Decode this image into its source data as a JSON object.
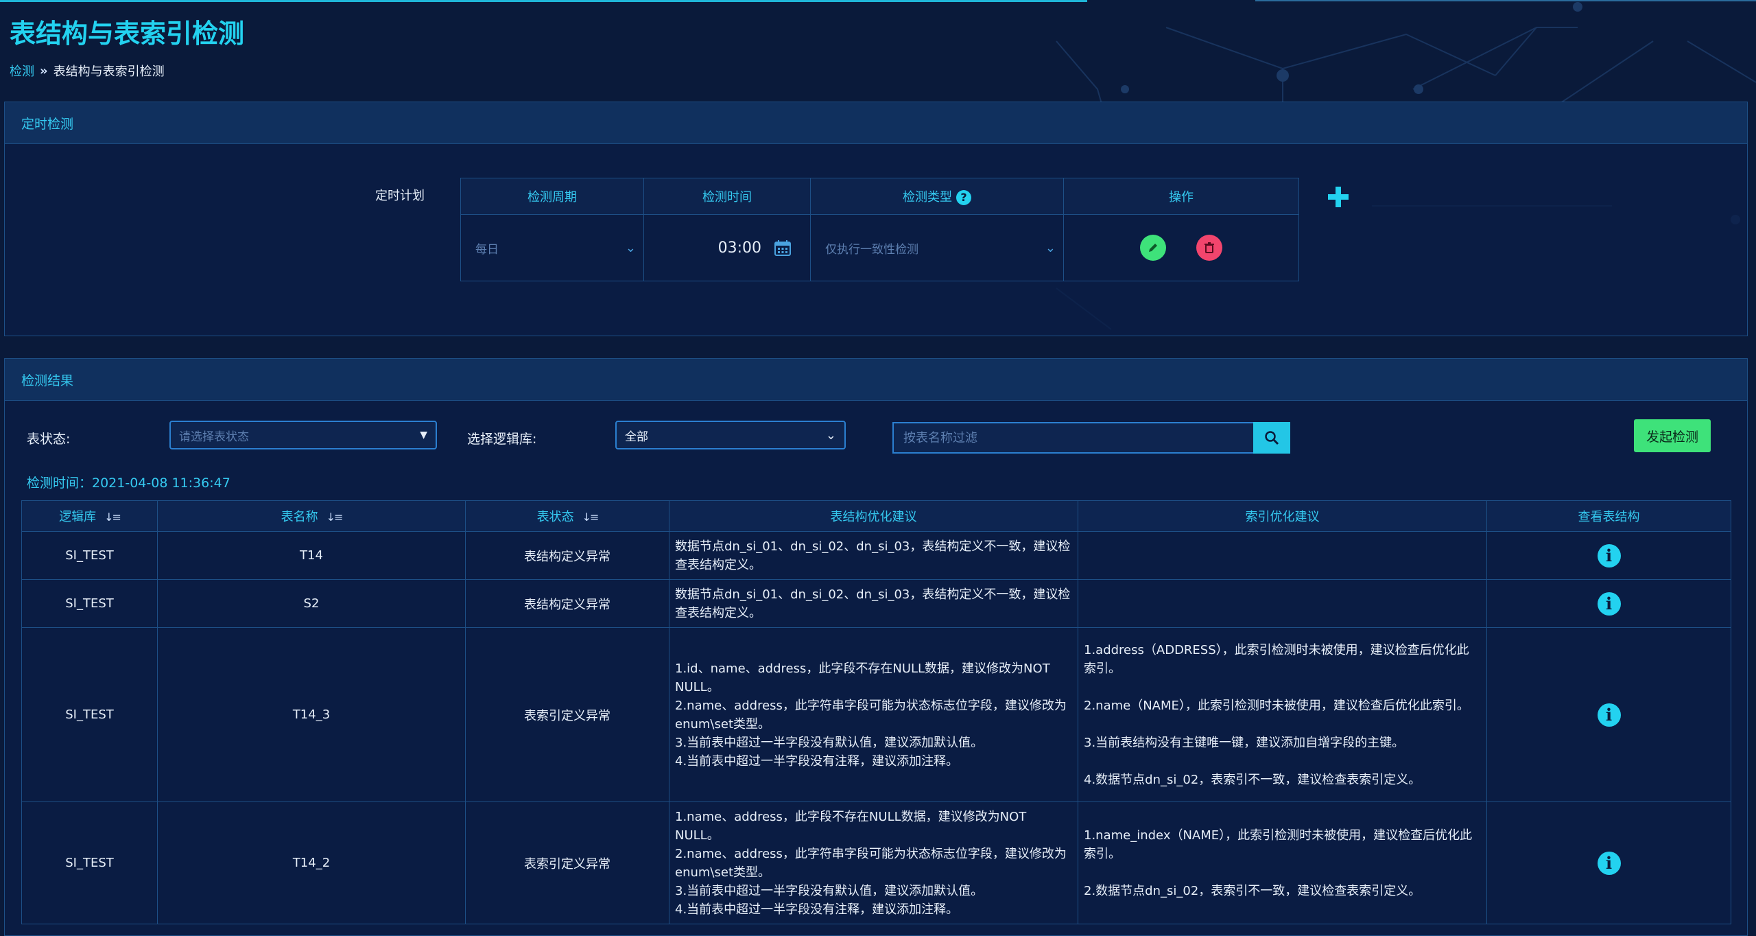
{
  "page": {
    "title": "表结构与表索引检测",
    "breadcrumb": {
      "parent": "检测",
      "separator": "»",
      "current": "表结构与表索引检测"
    }
  },
  "schedule_panel": {
    "title": "定时检测",
    "plan_label": "定时计划",
    "columns": {
      "period": "检测周期",
      "time": "检测时间",
      "type": "检测类型",
      "actions": "操作"
    },
    "row": {
      "period": "每日",
      "time": "03:00",
      "type": "仅执行一致性检测"
    },
    "icons": {
      "help": "question-icon",
      "edit": "pencil-icon",
      "delete": "trash-icon",
      "add": "plus-icon",
      "calendar": "calendar-icon"
    }
  },
  "results_panel": {
    "title": "检测结果",
    "filters": {
      "status_label": "表状态:",
      "status_placeholder": "请选择表状态",
      "db_label": "选择逻辑库:",
      "db_value": "全部",
      "search_placeholder": "按表名称过滤"
    },
    "launch_button": "发起检测",
    "check_time": "检测时间：2021-04-08 11:36:47",
    "table": {
      "headers": [
        "逻辑库",
        "表名称",
        "表状态",
        "表结构优化建议",
        "索引优化建议",
        "查看表结构"
      ],
      "rows": [
        {
          "db": "SI_TEST",
          "name": "T14",
          "status": "表结构定义异常",
          "structure": "数据节点dn_si_01、dn_si_02、dn_si_03，表结构定义不一致，建议检查表结构定义。",
          "index": ""
        },
        {
          "db": "SI_TEST",
          "name": "S2",
          "status": "表结构定义异常",
          "structure": "数据节点dn_si_01、dn_si_02、dn_si_03，表结构定义不一致，建议检查表结构定义。",
          "index": ""
        },
        {
          "db": "SI_TEST",
          "name": "T14_3",
          "status": "表索引定义异常",
          "structure": "1.id、name、address，此字段不存在NULL数据，建议修改为NOT NULL。\n2.name、address，此字符串字段可能为状态标志位字段，建议修改为enum\\set类型。\n3.当前表中超过一半字段没有默认值，建议添加默认值。\n4.当前表中超过一半字段没有注释，建议添加注释。",
          "index": "1.address（ADDRESS），此索引检测时未被使用，建议检查后优化此索引。\n\n2.name（NAME），此索引检测时未被使用，建议检查后优化此索引。\n\n3.当前表结构没有主键唯一键，建议添加自增字段的主键。\n\n4.数据节点dn_si_02，表索引不一致，建议检查表索引定义。"
        },
        {
          "db": "SI_TEST",
          "name": "T14_2",
          "status": "表索引定义异常",
          "structure": "1.name、address，此字段不存在NULL数据，建议修改为NOT NULL。\n2.name、address，此字符串字段可能为状态标志位字段，建议修改为enum\\set类型。\n3.当前表中超过一半字段没有默认值，建议添加默认值。\n4.当前表中超过一半字段没有注释，建议添加注释。",
          "index": "1.name_index（NAME），此索引检测时未被使用，建议检查后优化此索引。\n\n2.数据节点dn_si_02，表索引不一致，建议检查表索引定义。"
        }
      ]
    }
  },
  "colors": {
    "background": "#0a1a3a",
    "accent": "#23d2f0",
    "green": "#3ee27a",
    "red": "#f2456d"
  }
}
